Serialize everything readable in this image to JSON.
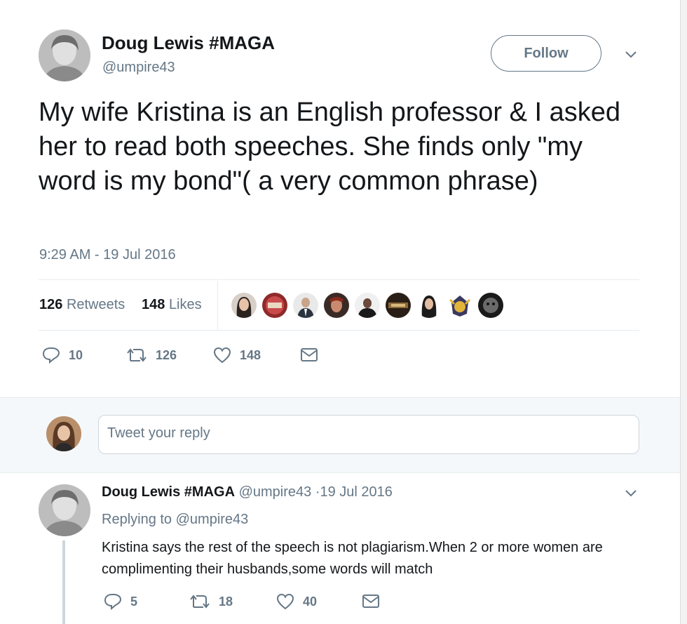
{
  "tweet": {
    "display_name": "Doug Lewis #MAGA",
    "handle": "@umpire43",
    "follow_label": "Follow",
    "text": "My wife Kristina is an English professor & I asked her to read both speeches. She finds only \"my word is my bond\"( a very common phrase)",
    "timestamp": "9:29 AM - 19 Jul 2016",
    "retweets_count": "126",
    "retweets_label": "Retweets",
    "likes_count": "148",
    "likes_label": "Likes",
    "liker_avatars": [
      "avatar-1",
      "avatar-2",
      "avatar-3",
      "avatar-4",
      "avatar-5",
      "avatar-6",
      "avatar-7",
      "avatar-8",
      "avatar-9"
    ],
    "actions": {
      "reply_icon": "reply-icon",
      "reply_count": "10",
      "retweet_icon": "retweet-icon",
      "retweet_count": "126",
      "like_icon": "heart-icon",
      "like_count": "148",
      "dm_icon": "envelope-icon"
    }
  },
  "reply_box": {
    "placeholder": "Tweet your reply"
  },
  "reply": {
    "display_name": "Doug Lewis #MAGA",
    "handle": "@umpire43",
    "date": "·19 Jul 2016",
    "replying_to": "Replying to @umpire43",
    "text": "Kristina says the rest of the speech is not plagiarism.When 2 or more women are complimenting their husbands,some words will match",
    "actions": {
      "reply_count": "5",
      "retweet_count": "18",
      "like_count": "40"
    }
  },
  "colors": {
    "text_primary": "#14171a",
    "text_secondary": "#657786",
    "divider": "#e6ecf0",
    "reply_bg": "#f5f8fa"
  }
}
